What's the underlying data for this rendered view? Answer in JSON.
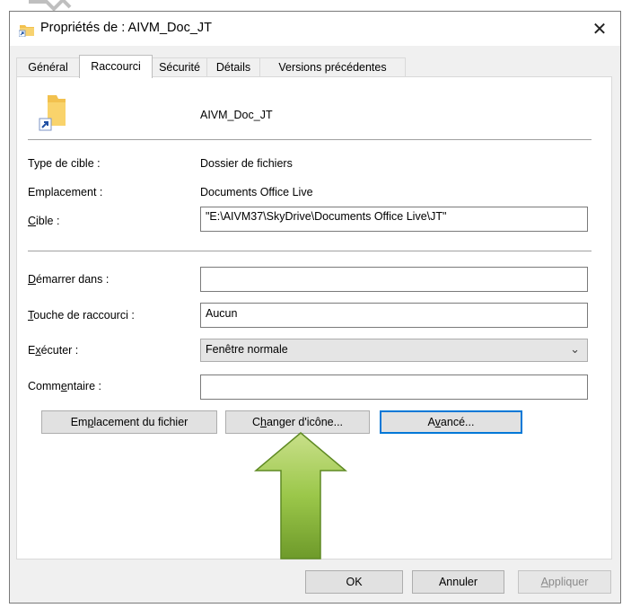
{
  "window": {
    "title": "Propriétés de : AIVM_Doc_JT",
    "close_glyph": "✕"
  },
  "tabs": [
    {
      "label": "Général"
    },
    {
      "label": "Raccourci"
    },
    {
      "label": "Sécurité"
    },
    {
      "label": "Détails"
    },
    {
      "label": "Versions précédentes"
    }
  ],
  "shortcut": {
    "name": "AIVM_Doc_JT",
    "target_type_label": "Type de cible :",
    "target_type_value": "Dossier de fichiers",
    "location_label": "Emplacement :",
    "location_value": "Documents Office Live",
    "target_label_u": "C",
    "target_label_rest": "ible :",
    "target_value": "\"E:\\AIVM37\\SkyDrive\\Documents Office Live\\JT\"",
    "start_in_label_u": "D",
    "start_in_label_rest": "émarrer dans :",
    "start_in_value": "",
    "hotkey_label_u": "T",
    "hotkey_label_rest": "ouche de raccourci :",
    "hotkey_value": "Aucun",
    "run_label_pre": "E",
    "run_label_u": "x",
    "run_label_rest": "écuter :",
    "run_value": "Fenêtre normale",
    "comment_label_pre": "Comm",
    "comment_label_u": "e",
    "comment_label_rest": "ntaire :",
    "comment_value": ""
  },
  "buttons": {
    "open_location_pre": "Em",
    "open_location_u": "p",
    "open_location_rest": "lacement du fichier",
    "change_icon_pre": "C",
    "change_icon_u": "h",
    "change_icon_rest": "anger d'icône...",
    "advanced_pre": "A",
    "advanced_u": "v",
    "advanced_rest": "ancé...",
    "ok": "OK",
    "cancel": "Annuler",
    "apply_u": "A",
    "apply_rest": "ppliquer"
  },
  "icons": {
    "title_icon": "folder-shortcut-icon",
    "shortcut_icon": "folder-shortcut-icon",
    "pointer": "green-up-arrow"
  },
  "colors": {
    "arrow_fill": "#8cbf3f",
    "focus_border": "#0078d7"
  }
}
